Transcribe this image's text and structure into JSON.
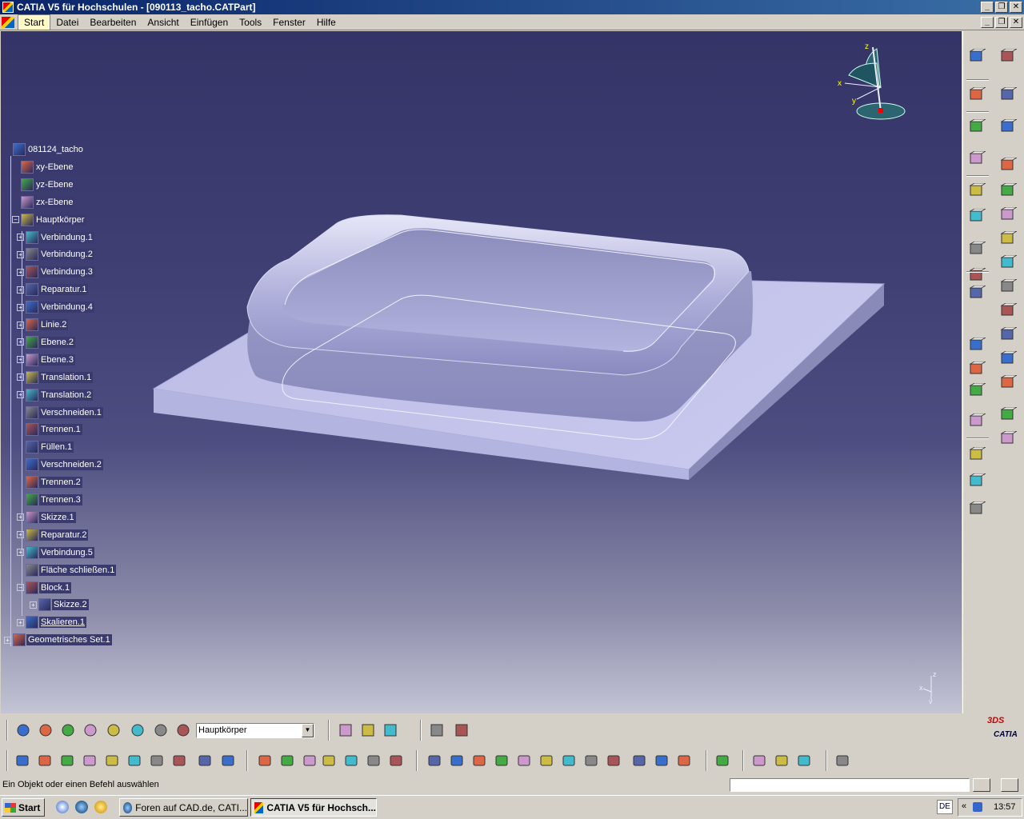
{
  "window": {
    "title": "CATIA V5 für Hochschulen - [090113_tacho.CATPart]",
    "btn_minimize": "_",
    "btn_restore": "❐",
    "btn_close": "✕"
  },
  "menu": {
    "items": [
      "Start",
      "Datei",
      "Bearbeiten",
      "Ansicht",
      "Einfügen",
      "Tools",
      "Fenster",
      "Hilfe"
    ]
  },
  "tree": {
    "nodes": [
      {
        "label": "081124_tacho",
        "level": 0,
        "expander": "",
        "icon": "part-icon"
      },
      {
        "label": "xy-Ebene",
        "level": 1,
        "expander": "",
        "icon": "plane-icon"
      },
      {
        "label": "yz-Ebene",
        "level": 1,
        "expander": "",
        "icon": "plane-icon"
      },
      {
        "label": "zx-Ebene",
        "level": 1,
        "expander": "",
        "icon": "plane-icon"
      },
      {
        "label": "Hauptkörper",
        "level": 1,
        "expander": "−",
        "icon": "body-icon"
      },
      {
        "label": "Verbindung.1",
        "level": 2,
        "expander": "+",
        "icon": "join-icon"
      },
      {
        "label": "Verbindung.2",
        "level": 2,
        "expander": "+",
        "icon": "join-icon"
      },
      {
        "label": "Verbindung.3",
        "level": 2,
        "expander": "+",
        "icon": "join-icon"
      },
      {
        "label": "Reparatur.1",
        "level": 2,
        "expander": "+",
        "icon": "repair-icon"
      },
      {
        "label": "Verbindung.4",
        "level": 2,
        "expander": "+",
        "icon": "join-icon"
      },
      {
        "label": "Linie.2",
        "level": 2,
        "expander": "+",
        "icon": "line-icon"
      },
      {
        "label": "Ebene.2",
        "level": 2,
        "expander": "+",
        "icon": "plane-icon"
      },
      {
        "label": "Ebene.3",
        "level": 2,
        "expander": "+",
        "icon": "plane-icon"
      },
      {
        "label": "Translation.1",
        "level": 2,
        "expander": "+",
        "icon": "translate-icon"
      },
      {
        "label": "Translation.2",
        "level": 2,
        "expander": "+",
        "icon": "translate-icon"
      },
      {
        "label": "Verschneiden.1",
        "level": 2,
        "expander": "",
        "icon": "intersect-icon"
      },
      {
        "label": "Trennen.1",
        "level": 2,
        "expander": "",
        "icon": "split-icon"
      },
      {
        "label": "Füllen.1",
        "level": 2,
        "expander": "",
        "icon": "fill-icon"
      },
      {
        "label": "Verschneiden.2",
        "level": 2,
        "expander": "",
        "icon": "intersect-icon"
      },
      {
        "label": "Trennen.2",
        "level": 2,
        "expander": "",
        "icon": "split-icon"
      },
      {
        "label": "Trennen.3",
        "level": 2,
        "expander": "",
        "icon": "split-icon"
      },
      {
        "label": "Skizze.1",
        "level": 2,
        "expander": "+",
        "icon": "sketch-icon"
      },
      {
        "label": "Reparatur.2",
        "level": 2,
        "expander": "+",
        "icon": "repair-icon"
      },
      {
        "label": "Verbindung.5",
        "level": 2,
        "expander": "+",
        "icon": "join-icon"
      },
      {
        "label": "Fläche schließen.1",
        "level": 2,
        "expander": "",
        "icon": "close-surface-icon"
      },
      {
        "label": "Block.1",
        "level": 2,
        "expander": "−",
        "icon": "pad-icon"
      },
      {
        "label": "Skizze.2",
        "level": 3,
        "expander": "+",
        "icon": "sketch-icon"
      },
      {
        "label": "Skalieren.1",
        "level": 2,
        "expander": "+",
        "icon": "scale-icon"
      },
      {
        "label": "Geometrisches Set.1",
        "level": 0,
        "expander": "+",
        "icon": "geoset-icon"
      }
    ]
  },
  "compass": {
    "x": "x",
    "y": "y",
    "z": "z"
  },
  "toolbar": {
    "body_select": "Hauptkörper",
    "icons_row1": [
      "refresh-icon",
      "select-icon",
      "axis-icon",
      "measure-icon",
      "datum-icon",
      "compass-icon",
      "stack-icon",
      "layer-icon"
    ],
    "icons_row1b": [
      "plane-tool-icon",
      "analysis-icon",
      "navigator-icon",
      "sheet-icon",
      "sheets-icon"
    ],
    "icons_row2": [
      "new-icon",
      "open-icon",
      "save-icon",
      "print-icon",
      "cut-icon",
      "copy-icon",
      "paste-icon",
      "undo-icon",
      "redo-icon",
      "help-icon",
      "formula-icon",
      "comment-icon",
      "knowledge-icon",
      "table-icon",
      "tree-icon",
      "lock-icon",
      "law-icon",
      "fly-icon",
      "fit-all-icon",
      "pan-icon",
      "rotate-icon",
      "zoom-in-icon",
      "zoom-out-icon",
      "normal-view-icon",
      "views-icon",
      "iso-view-icon",
      "shading-icon",
      "hide-show-icon",
      "swap-icon",
      "multiview-icon",
      "measure-between-icon",
      "measure-item-icon",
      "inertia-icon",
      "capture-icon"
    ]
  },
  "right_toolbar": {
    "icons": [
      "eraser-icon",
      "gear-icon",
      "sketch-tool-icon",
      "cursor-icon",
      "axis-system-icon",
      "sketcher-icon",
      "text-icon",
      "pad-tool-icon",
      "point-icon",
      "pocket-icon",
      "line-tool-icon",
      "shaft-icon",
      "plane-tool-icon",
      "groove-icon",
      "hole-icon",
      "rib-icon",
      "slot-icon",
      "solid-icon",
      "stiffener-icon",
      "loft-icon",
      "fillet-icon",
      "chamfer-icon",
      "draft-icon",
      "shell-icon",
      "thickness-icon",
      "thread-icon",
      "pattern-icon",
      "mirror-icon",
      "boolean-icon",
      "scale-tool-icon",
      "inertia-tool-icon"
    ]
  },
  "status": {
    "text": "Ein Objekt oder einen Befehl auswählen",
    "input_placeholder": ""
  },
  "taskbar": {
    "start_label": "Start",
    "tasks": [
      {
        "label": "Foren auf CAD.de, CATI...",
        "active": false
      },
      {
        "label": "CATIA V5 für Hochsch...",
        "active": true
      }
    ],
    "language": "DE",
    "clock": "13:57"
  },
  "brand": {
    "logo_text": "CATIA",
    "logo_mark": "3DS"
  },
  "colors": {
    "viewport_top": "#343467",
    "viewport_bottom": "#c4c4d6",
    "model_fill": "#c0c0e8",
    "tree_label_bg": "#3a3a6e",
    "title_left": "#0a246a"
  }
}
